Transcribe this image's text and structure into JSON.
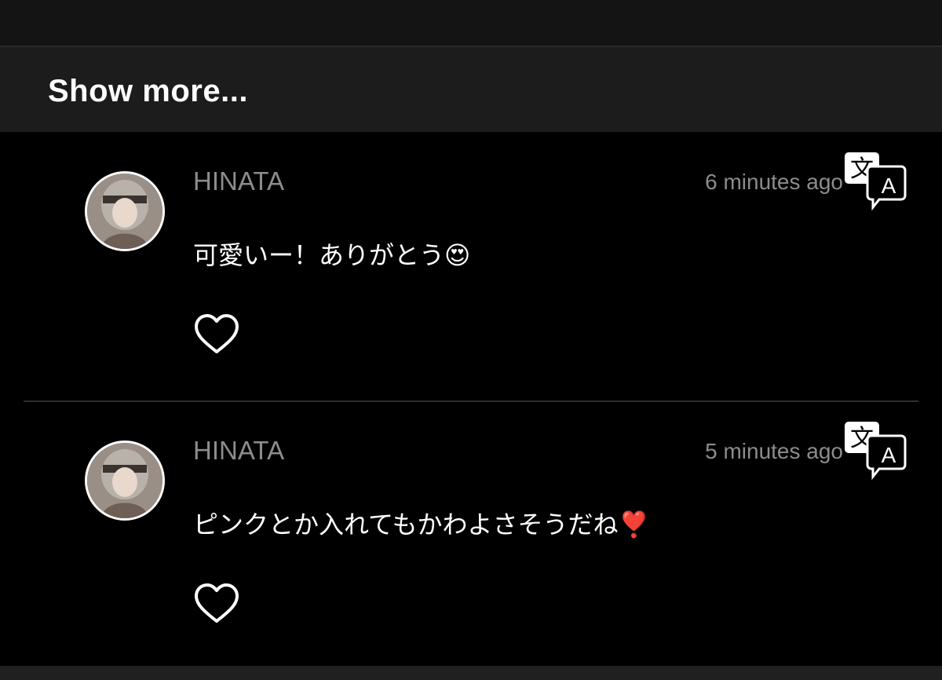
{
  "show_more": {
    "label": "Show more..."
  },
  "comments": [
    {
      "username": "HINATA",
      "time": "6 minutes ago",
      "text": "可愛いー！ありがとう😍",
      "like_icon": "heart-outline-icon",
      "translate_icon": "translate-icon"
    },
    {
      "username": "HINATA",
      "time": "5 minutes ago",
      "text": "ピンクとか入れてもかわよさそうだね❣️",
      "like_icon": "heart-outline-icon",
      "translate_icon": "translate-icon"
    }
  ],
  "colors": {
    "background": "#000000",
    "show_more_bg": "#1c1c1c",
    "meta_text": "#8c8c8c",
    "primary_text": "#ffffff"
  }
}
